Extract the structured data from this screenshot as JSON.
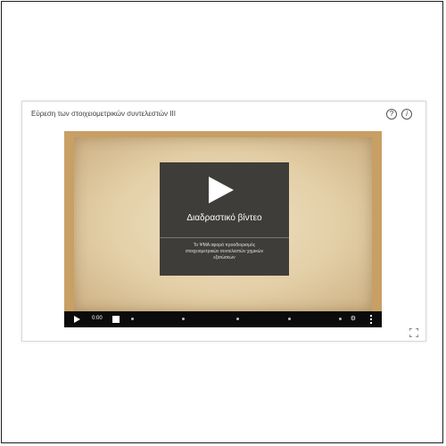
{
  "window": {
    "title": "Εύρεση των στοιχειομετρικών συντελεστών III"
  },
  "header_icons": {
    "help": "?",
    "info": "i"
  },
  "video": {
    "overlay_title": "Διαδραστικό βίντεο",
    "description": "Το ΨΜΑ αφορά προσδιορισμός στοιχειομετρικών συντελεστών χημικών εξισώσεων",
    "current_time": "0:00",
    "icons": {
      "play": "play-icon",
      "settings": "gear-icon",
      "more": "more-vertical-icon",
      "expand": "expand-icon"
    }
  },
  "colors": {
    "frame_border": "#c89f65",
    "overlay": "#3f3d3a",
    "controls_bar": "#0b0b0b"
  }
}
